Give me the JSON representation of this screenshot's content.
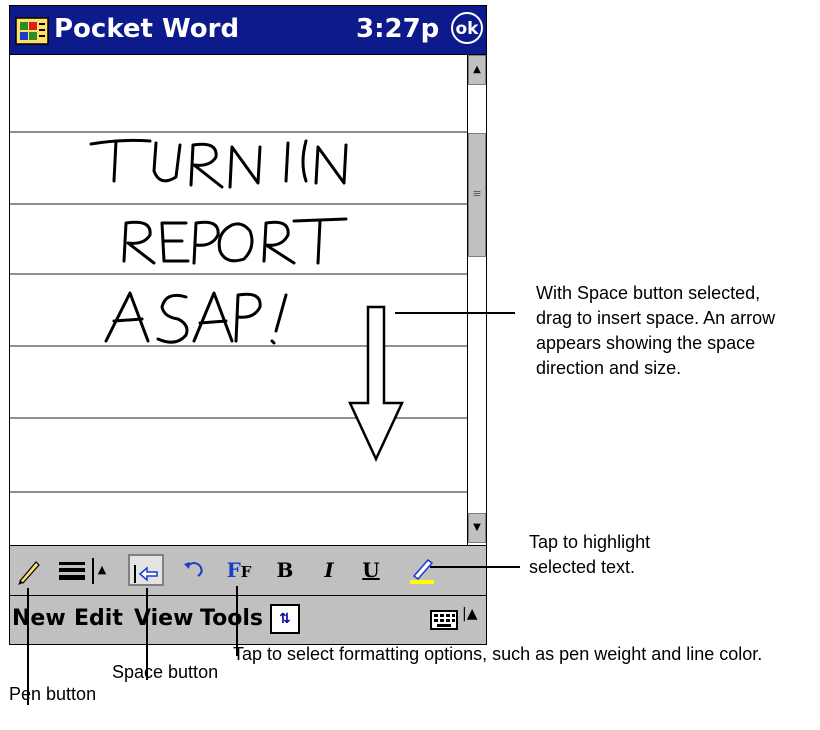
{
  "titlebar": {
    "app_title": "Pocket Word",
    "time": "3:27p",
    "ok_label": "ok",
    "icon": "pocket-word-app-icon"
  },
  "document": {
    "ink_note_lines": [
      "TURN IN",
      "REPORT",
      "ASAP!"
    ],
    "space_arrow": "down-arrow-insert-space"
  },
  "scrollbar": {
    "up_icon": "scroll-up-arrow",
    "thumb_icon": "scroll-grip",
    "down_icon": "scroll-down-arrow"
  },
  "toolbar": {
    "pen_icon": "pen-icon",
    "line_weight_icon": "line-weight-icon",
    "space_icon": "space-insert-icon",
    "undo_icon": "undo-icon",
    "format_icon": "format-icon",
    "bold_label": "B",
    "italic_label": "I",
    "underline_label": "U",
    "highlight_icon": "highlighter-icon"
  },
  "menubar": {
    "menus": [
      "New",
      "Edit",
      "View",
      "Tools"
    ],
    "input_icon": "input-method-toggle-icon",
    "keyboard_icon": "keyboard-icon"
  },
  "callouts": {
    "space_arrow": [
      "With Space button selected,",
      "drag to insert space. An arrow",
      "appears showing the space",
      "direction and size."
    ],
    "highlight": [
      "Tap to highlight",
      "selected text."
    ],
    "format": "Tap to select formatting options, such as pen weight and line color.",
    "space_button": "Space button",
    "pen_button": "Pen button"
  },
  "colors": {
    "titlebar_bg": "#0c1a8c",
    "toolbar_bg": "#c0c0c0",
    "highlight": "#ffff00",
    "format_accent": "#1a3cc8"
  }
}
